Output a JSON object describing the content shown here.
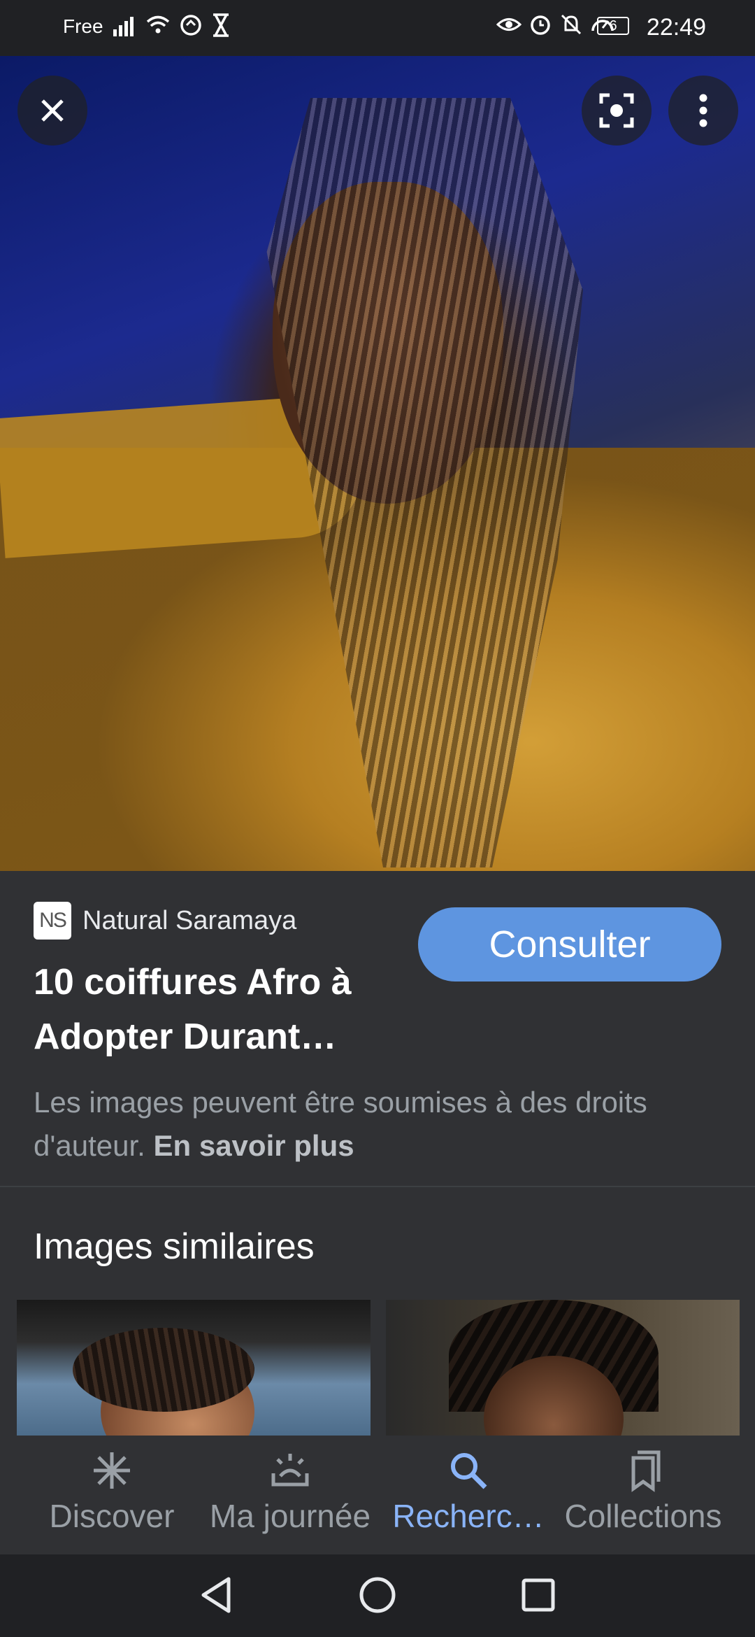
{
  "status_bar": {
    "carrier": "Free",
    "battery": "6",
    "time": "22:49",
    "left_icons": [
      "signal-icon",
      "wifi-icon",
      "data-saver-icon",
      "hourglass-icon"
    ],
    "right_icons": [
      "eye-icon",
      "alarm-icon",
      "bell-off-icon",
      "speed-icon"
    ]
  },
  "viewer": {
    "icons": [
      "close-icon",
      "lens-icon",
      "more-vert-icon"
    ]
  },
  "result": {
    "favicon_text": "NS",
    "source": "Natural Saramaya",
    "title": "10 coiffures Afro à Adopter Durant…",
    "consult_button": "Consulter",
    "copyright_text": "Les images peuvent être soumises à des droits d'auteur.",
    "learn_more": "En savoir plus"
  },
  "similar": {
    "title": "Images similaires"
  },
  "bottom_nav": {
    "items": [
      {
        "label": "Discover",
        "icon": "asterisk-icon"
      },
      {
        "label": "Ma journée",
        "icon": "sunrise-icon"
      },
      {
        "label": "Recherc…",
        "icon": "search-icon"
      },
      {
        "label": "Collections",
        "icon": "bookmarks-icon"
      }
    ],
    "active_index": 2
  },
  "system_nav": {
    "icons": [
      "back-icon",
      "home-icon",
      "recents-icon"
    ]
  },
  "colors": {
    "background": "#303134",
    "accent_button": "#5e95e0",
    "active_nav": "#8ab4f8"
  }
}
